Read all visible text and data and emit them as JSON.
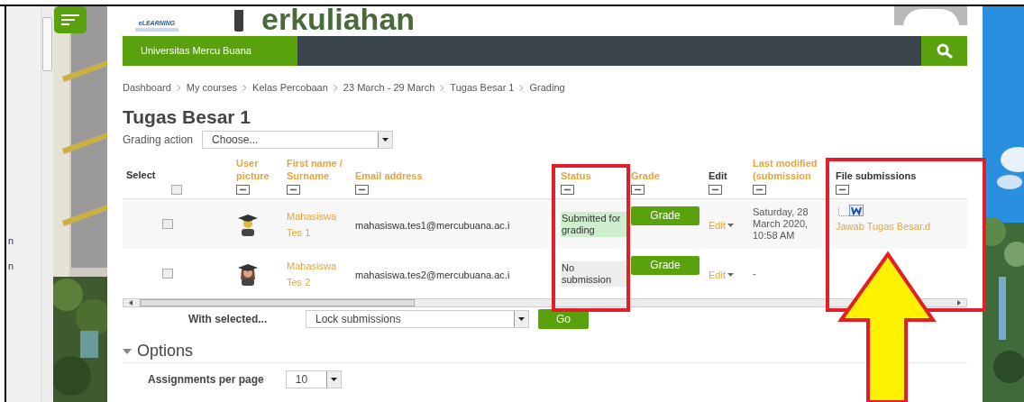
{
  "left_panel": {
    "items": [
      "n",
      "n"
    ]
  },
  "header": {
    "logo_small": "eLEARNING",
    "logo_text": "erkuliahan"
  },
  "navbar": {
    "site_name": "Universitas Mercu Buana"
  },
  "breadcrumb": [
    "Dashboard",
    "My courses",
    "Kelas Percobaan",
    "23 March - 29 March",
    "Tugas Besar 1",
    "Grading"
  ],
  "page_title": "Tugas Besar 1",
  "grading_action": {
    "label": "Grading action",
    "value": "Choose..."
  },
  "table": {
    "select_all": {
      "checked": false
    },
    "columns": [
      {
        "label": "Select",
        "kind": "select"
      },
      {
        "label": "User picture",
        "kind": "sortable"
      },
      {
        "label": "First name / Surname",
        "kind": "sortable"
      },
      {
        "label": "Email address",
        "kind": "sortable"
      },
      {
        "label": "Status",
        "kind": "sortable"
      },
      {
        "label": "Grade",
        "kind": "sortable"
      },
      {
        "label": "Edit",
        "kind": "plain"
      },
      {
        "label": "Last modified (submission",
        "kind": "sortable"
      },
      {
        "label": "File submissions",
        "kind": "plain"
      }
    ],
    "rows": [
      {
        "selected": false,
        "avatar": {
          "kind": "short_hair"
        },
        "name": "Mahasiswa Tes 1",
        "email": "mahasiswa.tes1@mercubuana.ac.i",
        "status": {
          "text": "Submitted for grading",
          "kind": "submitted"
        },
        "grade_button": "Grade",
        "edit": "Edit",
        "last_modified": "Saturday, 28 March 2020, 10:58 AM",
        "file": "Jawab Tugas Besar.d"
      },
      {
        "selected": false,
        "avatar": {
          "kind": "long_hair"
        },
        "name": "Mahasiswa Tes 2",
        "email": "mahasiswa.tes2@mercubuana.ac.i",
        "status": {
          "text": "No submission",
          "kind": "none"
        },
        "grade_button": "Grade",
        "edit": "Edit",
        "last_modified": "-"
      }
    ]
  },
  "with_selected": {
    "label": "With selected...",
    "value": "Lock submissions",
    "button": "Go"
  },
  "options": {
    "title": "Options",
    "expanded": true,
    "per_page": {
      "label": "Assignments per page",
      "value": "10"
    }
  }
}
